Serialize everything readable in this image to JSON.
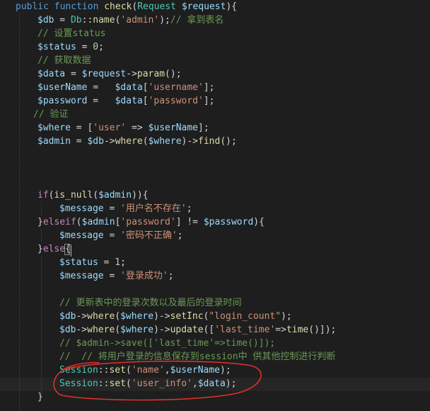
{
  "editor": {
    "lines": [
      {
        "tokens": [
          {
            "t": "public function ",
            "c": "kw"
          },
          {
            "t": "check",
            "c": "fn"
          },
          {
            "t": "(",
            "c": "tok"
          },
          {
            "t": "Request ",
            "c": "cls"
          },
          {
            "t": "$request",
            "c": "var"
          },
          {
            "t": "){",
            "c": "tok"
          }
        ]
      },
      {
        "tokens": [
          {
            "t": "$db",
            "c": "var"
          },
          {
            "t": " = ",
            "c": "tok"
          },
          {
            "t": "Db",
            "c": "cls"
          },
          {
            "t": "::",
            "c": "tok"
          },
          {
            "t": "name",
            "c": "fn"
          },
          {
            "t": "(",
            "c": "tok"
          },
          {
            "t": "'admin'",
            "c": "str"
          },
          {
            "t": ");",
            "c": "tok"
          },
          {
            "t": "// 拿到表名",
            "c": "cmt"
          }
        ]
      },
      {
        "tokens": [
          {
            "t": "// 设置status",
            "c": "cmt"
          }
        ]
      },
      {
        "tokens": [
          {
            "t": "$status",
            "c": "var"
          },
          {
            "t": " = ",
            "c": "tok"
          },
          {
            "t": "0",
            "c": "num"
          },
          {
            "t": ";",
            "c": "tok"
          }
        ]
      },
      {
        "tokens": [
          {
            "t": "// 获取数据",
            "c": "cmt"
          }
        ]
      },
      {
        "tokens": [
          {
            "t": "$data",
            "c": "var"
          },
          {
            "t": " = ",
            "c": "tok"
          },
          {
            "t": "$request",
            "c": "var"
          },
          {
            "t": "->",
            "c": "tok"
          },
          {
            "t": "param",
            "c": "fn"
          },
          {
            "t": "();",
            "c": "tok"
          }
        ]
      },
      {
        "tokens": [
          {
            "t": "$userName",
            "c": "var"
          },
          {
            "t": " =   ",
            "c": "tok"
          },
          {
            "t": "$data",
            "c": "var"
          },
          {
            "t": "[",
            "c": "tok"
          },
          {
            "t": "'username'",
            "c": "str"
          },
          {
            "t": "];",
            "c": "tok"
          }
        ]
      },
      {
        "tokens": [
          {
            "t": "$password",
            "c": "var"
          },
          {
            "t": " =   ",
            "c": "tok"
          },
          {
            "t": "$data",
            "c": "var"
          },
          {
            "t": "[",
            "c": "tok"
          },
          {
            "t": "'password'",
            "c": "str"
          },
          {
            "t": "];",
            "c": "tok"
          }
        ]
      },
      {
        "tokens": [
          {
            "t": "// 验证",
            "c": "cmt"
          }
        ]
      },
      {
        "tokens": [
          {
            "t": "$where",
            "c": "var"
          },
          {
            "t": " = [",
            "c": "tok"
          },
          {
            "t": "'user'",
            "c": "str"
          },
          {
            "t": " => ",
            "c": "tok"
          },
          {
            "t": "$userName",
            "c": "var"
          },
          {
            "t": "];",
            "c": "tok"
          }
        ]
      },
      {
        "tokens": [
          {
            "t": "$admin",
            "c": "var"
          },
          {
            "t": " = ",
            "c": "tok"
          },
          {
            "t": "$db",
            "c": "var"
          },
          {
            "t": "->",
            "c": "tok"
          },
          {
            "t": "where",
            "c": "fn"
          },
          {
            "t": "(",
            "c": "tok"
          },
          {
            "t": "$where",
            "c": "var"
          },
          {
            "t": ")->",
            "c": "tok"
          },
          {
            "t": "find",
            "c": "fn"
          },
          {
            "t": "();",
            "c": "tok"
          }
        ]
      },
      {
        "tokens": [
          {
            "t": "if",
            "c": "ctl"
          },
          {
            "t": "(",
            "c": "tok"
          },
          {
            "t": "is_null",
            "c": "fn"
          },
          {
            "t": "(",
            "c": "tok"
          },
          {
            "t": "$admin",
            "c": "var"
          },
          {
            "t": ")){",
            "c": "tok"
          }
        ]
      },
      {
        "tokens": [
          {
            "t": "$message",
            "c": "var"
          },
          {
            "t": " = ",
            "c": "tok"
          },
          {
            "t": "'用户名不存在'",
            "c": "str"
          },
          {
            "t": ";",
            "c": "tok"
          }
        ]
      },
      {
        "tokens": [
          {
            "t": "}",
            "c": "tok"
          },
          {
            "t": "elseif",
            "c": "ctl"
          },
          {
            "t": "(",
            "c": "tok"
          },
          {
            "t": "$admin",
            "c": "var"
          },
          {
            "t": "[",
            "c": "tok"
          },
          {
            "t": "'password'",
            "c": "str"
          },
          {
            "t": "] != ",
            "c": "tok"
          },
          {
            "t": "$password",
            "c": "var"
          },
          {
            "t": "){",
            "c": "tok"
          }
        ]
      },
      {
        "tokens": [
          {
            "t": "$message",
            "c": "var"
          },
          {
            "t": " = ",
            "c": "tok"
          },
          {
            "t": "'密码不正确'",
            "c": "str"
          },
          {
            "t": ";",
            "c": "tok"
          }
        ]
      },
      {
        "tokens": [
          {
            "t": "}",
            "c": "tok"
          },
          {
            "t": "else",
            "c": "ctl"
          },
          {
            "t": "{",
            "c": "tok"
          }
        ]
      },
      {
        "tokens": [
          {
            "t": "$status",
            "c": "var"
          },
          {
            "t": " = ",
            "c": "tok"
          },
          {
            "t": "1",
            "c": "num"
          },
          {
            "t": ";",
            "c": "tok"
          }
        ]
      },
      {
        "tokens": [
          {
            "t": "$message",
            "c": "var"
          },
          {
            "t": " = ",
            "c": "tok"
          },
          {
            "t": "'登录成功'",
            "c": "str"
          },
          {
            "t": ";",
            "c": "tok"
          }
        ]
      },
      {
        "tokens": [
          {
            "t": "// 更新表中的登录次数以及最后的登录时间",
            "c": "cmt"
          }
        ]
      },
      {
        "tokens": [
          {
            "t": "$db",
            "c": "var"
          },
          {
            "t": "->",
            "c": "tok"
          },
          {
            "t": "where",
            "c": "fn"
          },
          {
            "t": "(",
            "c": "tok"
          },
          {
            "t": "$where",
            "c": "var"
          },
          {
            "t": ")->",
            "c": "tok"
          },
          {
            "t": "setInc",
            "c": "fn"
          },
          {
            "t": "(",
            "c": "tok"
          },
          {
            "t": "\"login_count\"",
            "c": "str"
          },
          {
            "t": ");",
            "c": "tok"
          }
        ]
      },
      {
        "tokens": [
          {
            "t": "$db",
            "c": "var"
          },
          {
            "t": "->",
            "c": "tok"
          },
          {
            "t": "where",
            "c": "fn"
          },
          {
            "t": "(",
            "c": "tok"
          },
          {
            "t": "$where",
            "c": "var"
          },
          {
            "t": ")->",
            "c": "tok"
          },
          {
            "t": "update",
            "c": "fn"
          },
          {
            "t": "([",
            "c": "tok"
          },
          {
            "t": "'last_time'",
            "c": "str"
          },
          {
            "t": "=>",
            "c": "tok"
          },
          {
            "t": "time",
            "c": "fn"
          },
          {
            "t": "()]);",
            "c": "tok"
          }
        ]
      },
      {
        "tokens": [
          {
            "t": "// $admin->save(['last_time'=>time()]);",
            "c": "cmt"
          }
        ]
      },
      {
        "tokens": [
          {
            "t": "//  // 将用户登录的信息保存到session中 供其他控制进行判断",
            "c": "cmt"
          }
        ]
      },
      {
        "tokens": [
          {
            "t": "Session",
            "c": "cls"
          },
          {
            "t": "::",
            "c": "tok"
          },
          {
            "t": "set",
            "c": "fn"
          },
          {
            "t": "(",
            "c": "tok"
          },
          {
            "t": "'name'",
            "c": "str"
          },
          {
            "t": ",",
            "c": "tok"
          },
          {
            "t": "$userName",
            "c": "var"
          },
          {
            "t": ");",
            "c": "tok"
          }
        ]
      },
      {
        "tokens": [
          {
            "t": "Session",
            "c": "cls"
          },
          {
            "t": "::",
            "c": "tok"
          },
          {
            "t": "set",
            "c": "fn"
          },
          {
            "t": "(",
            "c": "tok"
          },
          {
            "t": "'user_info'",
            "c": "str"
          },
          {
            "t": ",",
            "c": "tok"
          },
          {
            "t": "$data",
            "c": "var"
          },
          {
            "t": ");",
            "c": "tok"
          }
        ]
      },
      {
        "tokens": [
          {
            "t": "}",
            "c": "tok"
          }
        ]
      }
    ]
  },
  "colors": {
    "background": "#1e1e1e",
    "keyword": "#569cd6",
    "function": "#dcdcaa",
    "class": "#4ec9b0",
    "variable": "#9cdcfe",
    "string": "#ce9178",
    "number": "#b5cea8",
    "comment": "#6a9955",
    "control": "#c586c0",
    "annotation": "#e0302a"
  }
}
